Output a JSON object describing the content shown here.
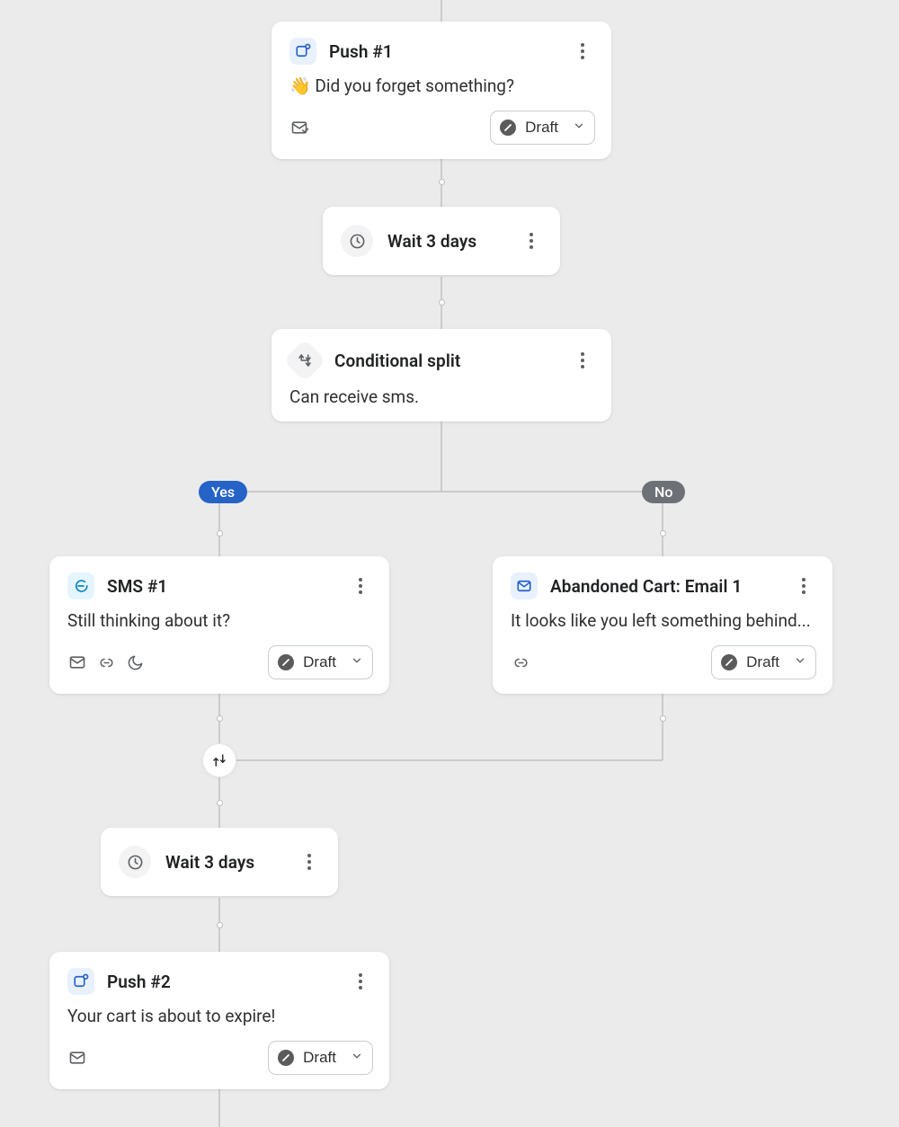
{
  "colors": {
    "bg": "#ebebeb",
    "card": "#ffffff",
    "yesPill": "#2563c7",
    "noPill": "#6d7175"
  },
  "labels": {
    "status": "Draft",
    "yes": "Yes",
    "no": "No"
  },
  "nodes": {
    "push1": {
      "title": "Push #1",
      "body": "👋 Did you forget something?",
      "status": "Draft"
    },
    "wait1": {
      "title": "Wait 3 days"
    },
    "cond": {
      "title": "Conditional split",
      "body": "Can receive sms."
    },
    "sms1": {
      "title": "SMS #1",
      "body": "Still thinking about it?",
      "status": "Draft"
    },
    "email1": {
      "title": "Abandoned Cart: Email 1",
      "body": "It looks like you left something behind...",
      "status": "Draft"
    },
    "wait2": {
      "title": "Wait 3 days"
    },
    "push2": {
      "title": "Push #2",
      "body": "Your cart is about to expire!",
      "status": "Draft"
    }
  }
}
